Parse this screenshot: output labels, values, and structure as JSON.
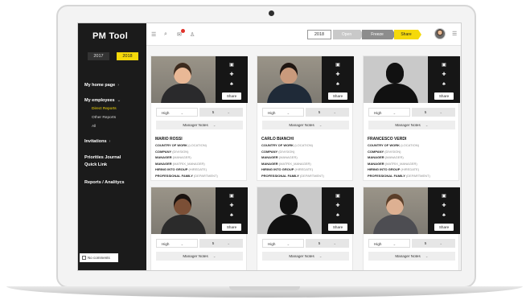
{
  "app": {
    "logo": "PM Tool"
  },
  "sidebar": {
    "years": [
      "2017",
      "2018"
    ],
    "active_year": "2018",
    "nav": [
      {
        "label": "My home page",
        "chev": "›"
      },
      {
        "label": "My employees",
        "chev": "⌄"
      },
      {
        "label": "Invitations",
        "chev": "›"
      },
      {
        "label": "Priorities Journal",
        "chev": ""
      },
      {
        "label": "Quick Link",
        "chev": ""
      },
      {
        "label": "Reports / Analitycs",
        "chev": ""
      }
    ],
    "sub_items": [
      "Direct Reports",
      "Other Reports",
      "All"
    ],
    "no_comments": "No comments"
  },
  "topbar": {
    "icons": [
      "menu-icon",
      "search-icon",
      "notifications-icon",
      "add-user-icon"
    ],
    "year": "2018",
    "stages": [
      "Open",
      "Freeze",
      "Share"
    ],
    "active_stage": "Share",
    "right_menu": "☰"
  },
  "cards": [
    {
      "name": "MARIO ROSSI",
      "photo": "real",
      "skin": "#e9b896",
      "hair": "#3b2a1e",
      "shirt": "#2a2a2c",
      "rating": "High",
      "score": "5",
      "notes": "Manager Notes",
      "share": "Share",
      "info": [
        {
          "k": "COUNTRY OF WORK",
          "v": "(LOCATION)"
        },
        {
          "k": "COMPANY",
          "v": "(DIVISION)"
        },
        {
          "k": "MANAGER",
          "v": "(MANAGER)"
        },
        {
          "k": "MANAGER",
          "v": "(MATRIX_MANAGER)"
        },
        {
          "k": "HIRING INTO GROUP",
          "v": "(HIREDATE)"
        },
        {
          "k": "PROFESSIONAL FAMILY",
          "v": "(DEPARTMENT)"
        }
      ]
    },
    {
      "name": "CARLO BIANCHI",
      "photo": "real",
      "skin": "#c99a7c",
      "hair": "#1e1612",
      "shirt": "#1f2a38",
      "rating": "High",
      "score": "5",
      "notes": "Manager Notes",
      "share": "Share",
      "info": [
        {
          "k": "COUNTRY OF WORK",
          "v": "(LOCATION)"
        },
        {
          "k": "COMPANY",
          "v": "(DIVISION)"
        },
        {
          "k": "MANAGER",
          "v": "(MANAGER)"
        },
        {
          "k": "MANAGER",
          "v": "(MATRIX_MANAGER)"
        },
        {
          "k": "HIRING INTO GROUP",
          "v": "(HIREDATE)"
        },
        {
          "k": "PROFESSIONAL FAMILY",
          "v": "(DEPARTMENT)"
        }
      ]
    },
    {
      "name": "FRANCESCO VERDI",
      "photo": "silhouette",
      "rating": "High",
      "score": "5",
      "notes": "Manager Notes",
      "share": "Share",
      "info": [
        {
          "k": "COUNTRY OF WORK",
          "v": "(LOCATION)"
        },
        {
          "k": "COMPANY",
          "v": "(DIVISION)"
        },
        {
          "k": "MANAGER",
          "v": "(MANAGER)"
        },
        {
          "k": "MANAGER",
          "v": "(MATRIX_MANAGER)"
        },
        {
          "k": "HIRING INTO GROUP",
          "v": "(HIREDATE)"
        },
        {
          "k": "PROFESSIONAL FAMILY",
          "v": "(DEPARTMENT)"
        }
      ]
    },
    {
      "name": "",
      "photo": "real",
      "skin": "#7b4f36",
      "hair": "#1a1310",
      "shirt": "#2b2b2b",
      "rating": "High",
      "score": "5",
      "notes": "Manager Notes",
      "share": "Share",
      "info": []
    },
    {
      "name": "",
      "photo": "silhouette",
      "rating": "High",
      "score": "5",
      "notes": "Manager Notes",
      "share": "Share",
      "info": []
    },
    {
      "name": "",
      "photo": "real",
      "skin": "#ddb092",
      "hair": "#5a3f2a",
      "shirt": "#4d4d52",
      "rating": "High",
      "score": "5",
      "notes": "Manager Notes",
      "share": "Share",
      "info": []
    }
  ]
}
